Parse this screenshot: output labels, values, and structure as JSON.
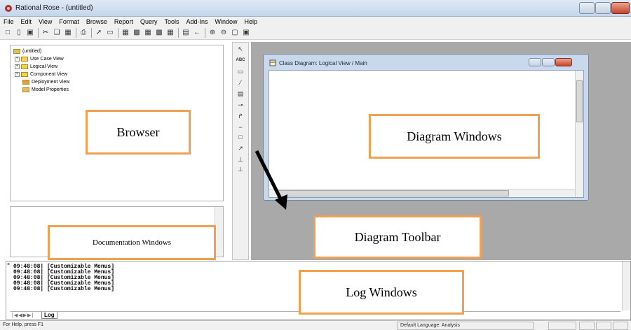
{
  "window": {
    "title": "Rational Rose - (untitled)"
  },
  "menu": [
    "File",
    "Edit",
    "View",
    "Format",
    "Browse",
    "Report",
    "Query",
    "Tools",
    "Add-Ins",
    "Window",
    "Help"
  ],
  "browser": {
    "root": "(untitled)",
    "items": [
      "Use Case View",
      "Logical View",
      "Component View",
      "Deployment View",
      "Model Properties"
    ]
  },
  "diagram_toolbar": {
    "text_tool": "ABC"
  },
  "diagram_window": {
    "title": "Class Diagram: Logical View / Main"
  },
  "log": {
    "lines": [
      "09:48:08| [Customizable Menus]",
      "09:48:08| [Customizable Menus]",
      "09:48:08| [Customizable Menus]",
      "09:48:08| [Customizable Menus]",
      "09:48:08| [Customizable Menus]"
    ],
    "tab": "Log"
  },
  "status": {
    "help": "For Help, press F1",
    "language": "Default Language: Analysis"
  },
  "callouts": {
    "browser": "Browser",
    "diagram_windows": "Diagram Windows",
    "documentation_windows": "Documentation Windows",
    "diagram_toolbar": "Diagram Toolbar",
    "log_windows": "Log Windows"
  },
  "colors": {
    "callout_border": "#f0a050",
    "diagram_bg": "#a9a9a9"
  }
}
